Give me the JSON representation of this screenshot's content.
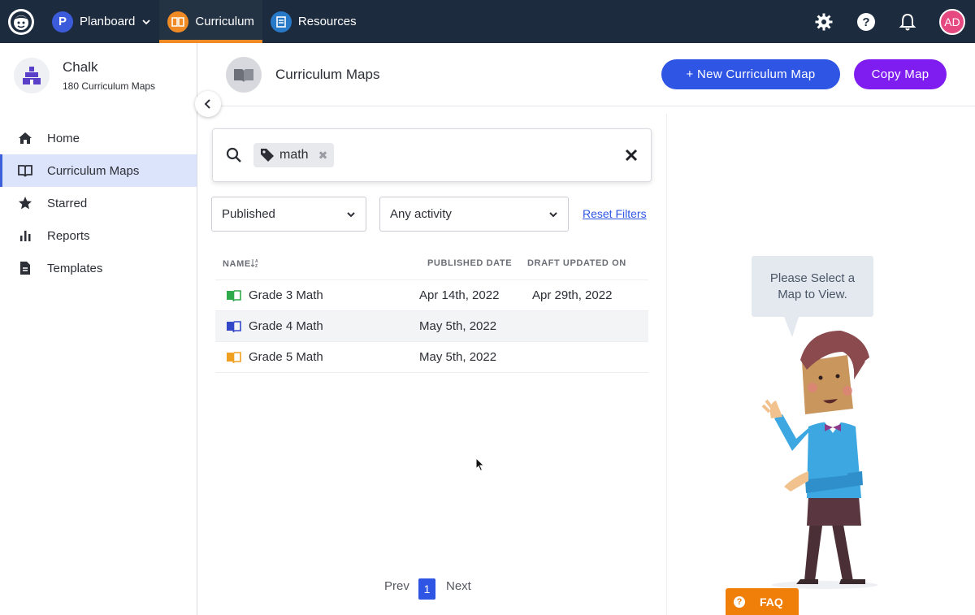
{
  "topnav": {
    "items": [
      {
        "label": "Planboard",
        "icon": "planboard-icon",
        "color": "#3b5bdb"
      },
      {
        "label": "Curriculum",
        "icon": "curriculum-icon",
        "color": "#f08a24"
      },
      {
        "label": "Resources",
        "icon": "resources-icon",
        "color": "#2979c9"
      }
    ],
    "avatar_initials": "AD",
    "icons": [
      "settings-icon",
      "help-icon",
      "bell-icon"
    ]
  },
  "sidebar": {
    "org_name": "Chalk",
    "org_subtitle": "180 Curriculum Maps",
    "items": [
      {
        "label": "Home",
        "icon": "home-icon"
      },
      {
        "label": "Curriculum Maps",
        "icon": "book-icon",
        "active": true
      },
      {
        "label": "Starred",
        "icon": "star-icon"
      },
      {
        "label": "Reports",
        "icon": "bar-chart-icon"
      },
      {
        "label": "Templates",
        "icon": "document-icon"
      }
    ]
  },
  "header": {
    "title": "Curriculum Maps",
    "new_button": "+ New Curriculum Map",
    "copy_button": "Copy Map"
  },
  "search": {
    "tag": "math"
  },
  "filters": {
    "status": "Published",
    "activity": "Any activity",
    "reset_label": "Reset Filters"
  },
  "table": {
    "columns": [
      "NAME",
      "PUBLISHED DATE",
      "DRAFT UPDATED ON"
    ],
    "rows": [
      {
        "name": "Grade 3 Math",
        "published": "Apr 14th, 2022",
        "draft_updated": "Apr 29th, 2022",
        "book_color": "#2eaa4a"
      },
      {
        "name": "Grade 4 Math",
        "published": "May 5th, 2022",
        "draft_updated": "",
        "book_color": "#3347c9"
      },
      {
        "name": "Grade 5 Math",
        "published": "May 5th, 2022",
        "draft_updated": "",
        "book_color": "#f0a020"
      }
    ]
  },
  "pagination": {
    "prev": "Prev",
    "current": "1",
    "next": "Next"
  },
  "right_panel": {
    "message": "Please Select a Map to View."
  },
  "faq": {
    "label": "FAQ"
  },
  "colors": {
    "primary": "#2f55e4",
    "purple": "#7f1df0",
    "nav_bg": "#1c2b3d",
    "faq": "#f07f0a"
  }
}
